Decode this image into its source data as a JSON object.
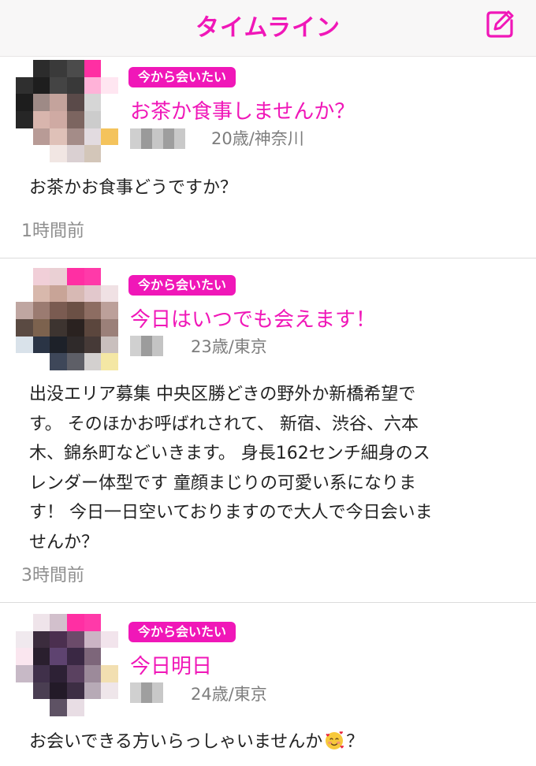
{
  "header": {
    "title": "タイムライン",
    "compose_icon": "compose-icon",
    "accent_color": "#f017b8"
  },
  "posts": [
    {
      "badge": "今から会いたい",
      "title": "お茶か食事しませんか？",
      "meta": "20歳/神奈川",
      "body": "お茶かお食事どうですか？",
      "time_ago": "1時間前"
    },
    {
      "badge": "今から会いたい",
      "title": "今日はいつでも会えます！",
      "meta": "23歳/東京",
      "body_lines": [
        "出没エリア募集 中央区勝どきの野外か新橋希望で",
        "す。 そのほかお呼ばれされて、 新宿、渋谷、六本",
        "木、錦糸町などいきます。 身長162センチ細身のス",
        "レンダー体型です 童顔まじりの可愛い系になりま",
        "す！ 今日一日空いておりますので大人で今日会いま",
        "せんか？"
      ],
      "time_ago": "3時間前"
    },
    {
      "badge": "今から会いたい",
      "title": "今日明日",
      "meta": "24歳/東京",
      "body_before_emoji": "お会いできる方いらっしゃいませんか",
      "body_emoji": "smiling-face-with-hearts-emoji",
      "body_after_emoji": "？"
    }
  ]
}
